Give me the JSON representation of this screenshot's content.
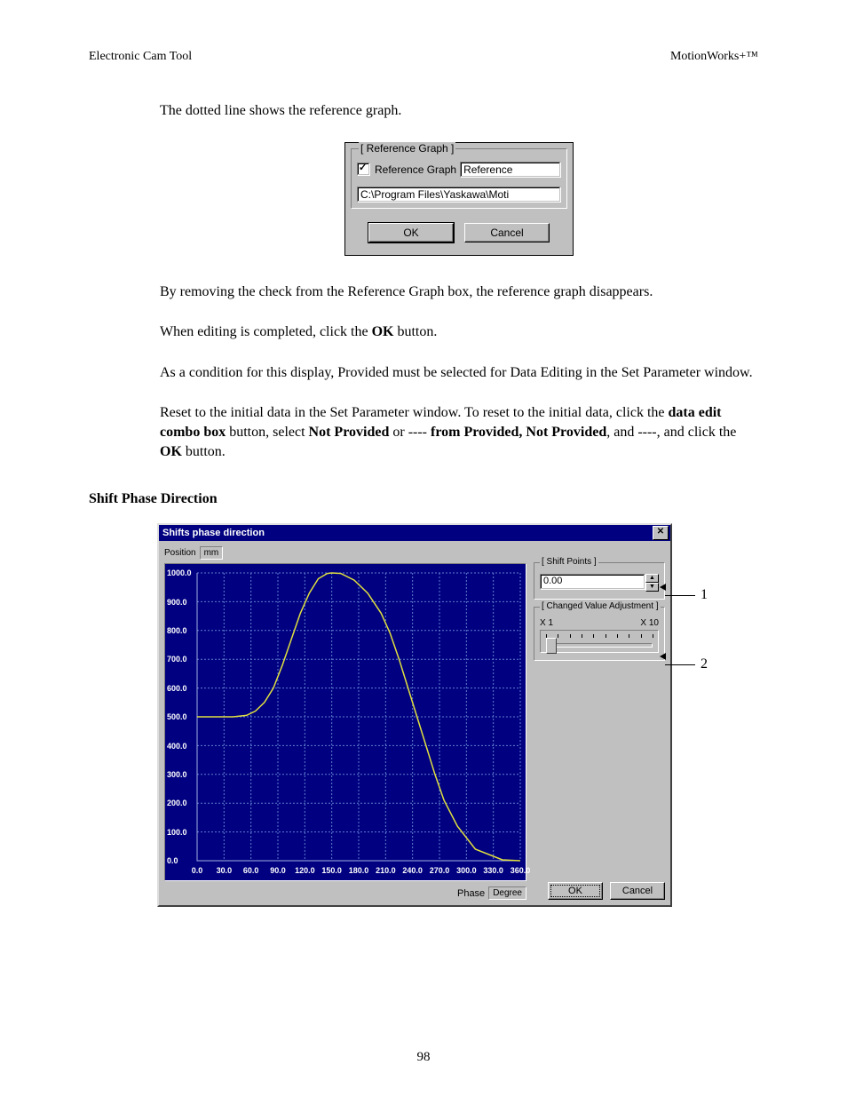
{
  "header": {
    "left": "Electronic Cam Tool",
    "right": "MotionWorks+™"
  },
  "intro": "The dotted line shows the reference graph.",
  "dlg1": {
    "group_title": "[ Reference Graph ]",
    "checkbox_label": "Reference Graph",
    "checkbox_checked": true,
    "ref_name": "Reference",
    "path": "C:\\Program Files\\Yaskawa\\Moti",
    "ok": "OK",
    "cancel": "Cancel"
  },
  "para2": "By removing the check from the Reference Graph box, the reference graph disappears.",
  "para3_pre": "When editing is completed, click the ",
  "para3_bold": "OK",
  "para3_post": " button.",
  "para4": "As a condition for this display, Provided must be selected for Data Editing in the Set Parameter window.",
  "para5_a": "Reset to the initial data in the Set Parameter window.  To reset to the initial data, click the ",
  "para5_b": "data edit combo box",
  "para5_c": " button, select ",
  "para5_d": "Not Provided",
  "para5_e": " or ---- ",
  "para5_f": "from Provided, Not Provided",
  "para5_g": ", and ----, and click the ",
  "para5_h": "OK",
  "para5_i": " button.",
  "section_heading": "Shift Phase Direction",
  "dlg2": {
    "title": "Shifts phase direction",
    "y_label": "Position",
    "y_unit": "mm",
    "x_label": "Phase",
    "x_unit": "Degree",
    "shift_points_title": "[ Shift Points ]",
    "shift_value": "0.00",
    "adj_title": "[ Changed Value Adjustment ]",
    "adj_min": "X 1",
    "adj_max": "X 10",
    "ok": "OK",
    "cancel": "Cancel"
  },
  "callouts": {
    "c1": "1",
    "c2": "2"
  },
  "chart_data": {
    "type": "line",
    "title": "",
    "xlabel": "Phase (Degree)",
    "ylabel": "Position (mm)",
    "xlim": [
      0,
      360
    ],
    "ylim": [
      0,
      1000
    ],
    "x_ticks": [
      0.0,
      30.0,
      60.0,
      90.0,
      120.0,
      150.0,
      180.0,
      210.0,
      240.0,
      270.0,
      300.0,
      330.0,
      360.0
    ],
    "y_ticks": [
      0.0,
      100.0,
      200.0,
      300.0,
      400.0,
      500.0,
      600.0,
      700.0,
      800.0,
      900.0,
      1000.0
    ],
    "series": [
      {
        "name": "Position",
        "x": [
          0,
          20,
          40,
          55,
          65,
          75,
          85,
          95,
          105,
          115,
          125,
          135,
          145,
          150,
          160,
          175,
          190,
          205,
          215,
          225,
          235,
          245,
          255,
          265,
          275,
          290,
          310,
          340,
          360
        ],
        "y": [
          500,
          500,
          500,
          505,
          520,
          550,
          600,
          680,
          770,
          860,
          930,
          980,
          998,
          1000,
          998,
          975,
          930,
          860,
          790,
          700,
          600,
          500,
          400,
          300,
          210,
          120,
          40,
          3,
          0
        ]
      }
    ]
  },
  "page_num": "98"
}
